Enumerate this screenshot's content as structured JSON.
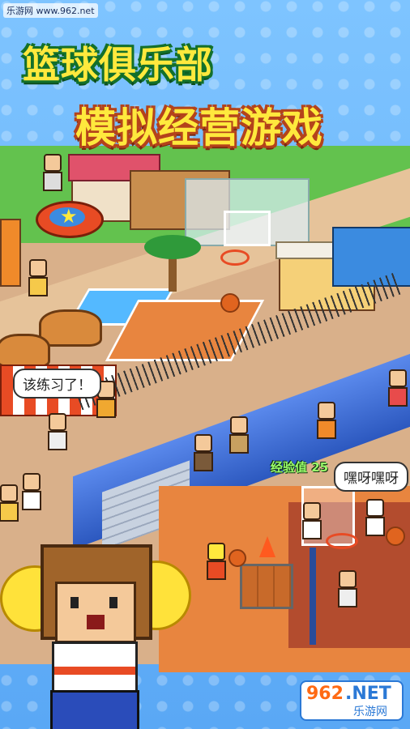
{
  "watermark": "乐游网 www.962.net",
  "title": {
    "line1": "篮球俱乐部",
    "line2": "模拟经营游戏"
  },
  "bubbles": {
    "practice": "该练习了！",
    "heave_ho": "嘿呀嘿呀"
  },
  "exp_label": "经验值 25",
  "logo": {
    "number": "962",
    "suffix": ".NET",
    "chinese": "乐游网"
  },
  "colors": {
    "title_fill": "#ffe93d",
    "title1_outline": "#13702b",
    "title2_outline": "#b4431b",
    "track": "#3e6ed8",
    "court": "#e8853f"
  }
}
